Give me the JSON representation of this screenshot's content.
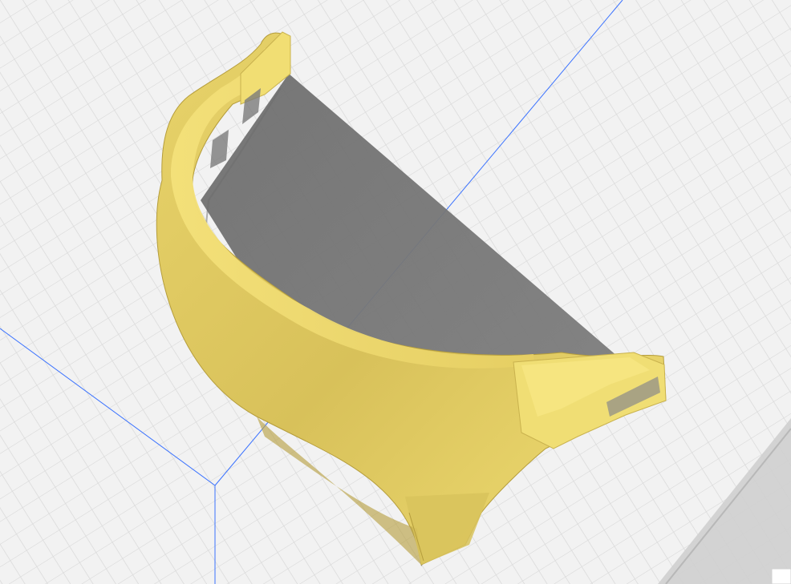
{
  "viewport": {
    "name": "3d-slicer-viewport"
  },
  "scene": {
    "background_color": "#f2f2f2",
    "grid_color": "#d6d6d6",
    "axis_color": "#3a72ff",
    "model_color": "#f2df73",
    "model_shade_color": "#c8b04c",
    "shadow_color": "#7a7a7a",
    "build_volume_color": "#cfcfcf"
  }
}
